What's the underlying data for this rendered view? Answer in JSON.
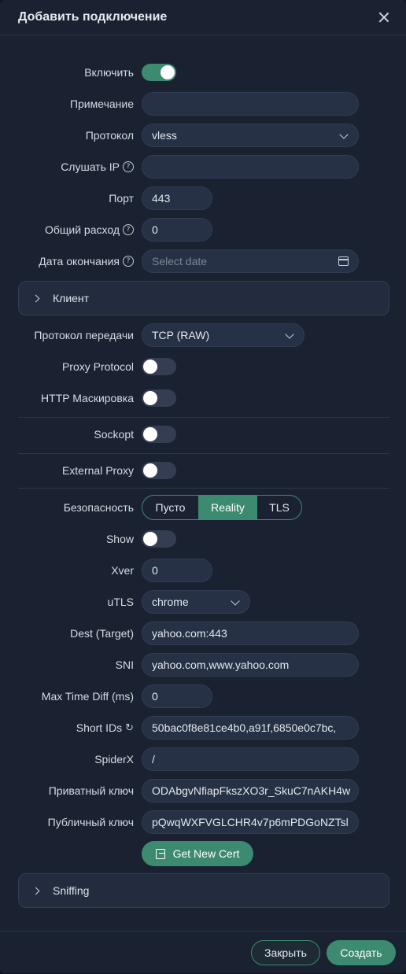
{
  "dialog": {
    "title": "Добавить подключение"
  },
  "fields": {
    "enable_label": "Включить",
    "remark_label": "Примечание",
    "remark_value": "",
    "protocol_label": "Протокол",
    "protocol_value": "vless",
    "listen_ip_label": "Слушать IP",
    "listen_ip_value": "",
    "port_label": "Порт",
    "port_value": "443",
    "total_usage_label": "Общий расход",
    "total_usage_value": "0",
    "expiry_label": "Дата окончания",
    "expiry_placeholder": "Select date"
  },
  "client_section": {
    "label": "Клиент"
  },
  "transport": {
    "protocol_label": "Протокол передачи",
    "protocol_value": "TCP (RAW)",
    "proxy_protocol_label": "Proxy Protocol",
    "http_masking_label": "HTTP Маскировка",
    "sockopt_label": "Sockopt",
    "external_proxy_label": "External Proxy"
  },
  "security": {
    "label": "Безопасность",
    "options": [
      "Пусто",
      "Reality",
      "TLS"
    ],
    "selected": "Reality"
  },
  "reality": {
    "show_label": "Show",
    "xver_label": "Xver",
    "xver_value": "0",
    "utls_label": "uTLS",
    "utls_value": "chrome",
    "dest_label": "Dest (Target)",
    "dest_value": "yahoo.com:443",
    "sni_label": "SNI",
    "sni_value": "yahoo.com,www.yahoo.com",
    "max_time_diff_label": "Max Time Diff (ms)",
    "max_time_diff_value": "0",
    "short_ids_label": "Short IDs",
    "short_ids_value": "50bac0f8e81ce4b0,a91f,6850e0c7bc,",
    "spiderx_label": "SpiderX",
    "spiderx_value": "/",
    "private_key_label": "Приватный ключ",
    "private_key_value": "ODAbgvNfiapFkszXO3r_SkuC7nAKH4w",
    "public_key_label": "Публичный ключ",
    "public_key_value": "pQwqWXFVGLCHR4v7p6mPDGoNZTsl",
    "get_cert_label": "Get New Cert"
  },
  "sniffing_section": {
    "label": "Sniffing"
  },
  "toggles": {
    "enable": true,
    "proxy_protocol": false,
    "http_masking": false,
    "sockopt": false,
    "external_proxy": false,
    "show": false
  },
  "footer": {
    "close_label": "Закрыть",
    "create_label": "Создать"
  },
  "colors": {
    "accent": "#3c8a6f",
    "background": "#1a2232",
    "field": "#273146"
  }
}
